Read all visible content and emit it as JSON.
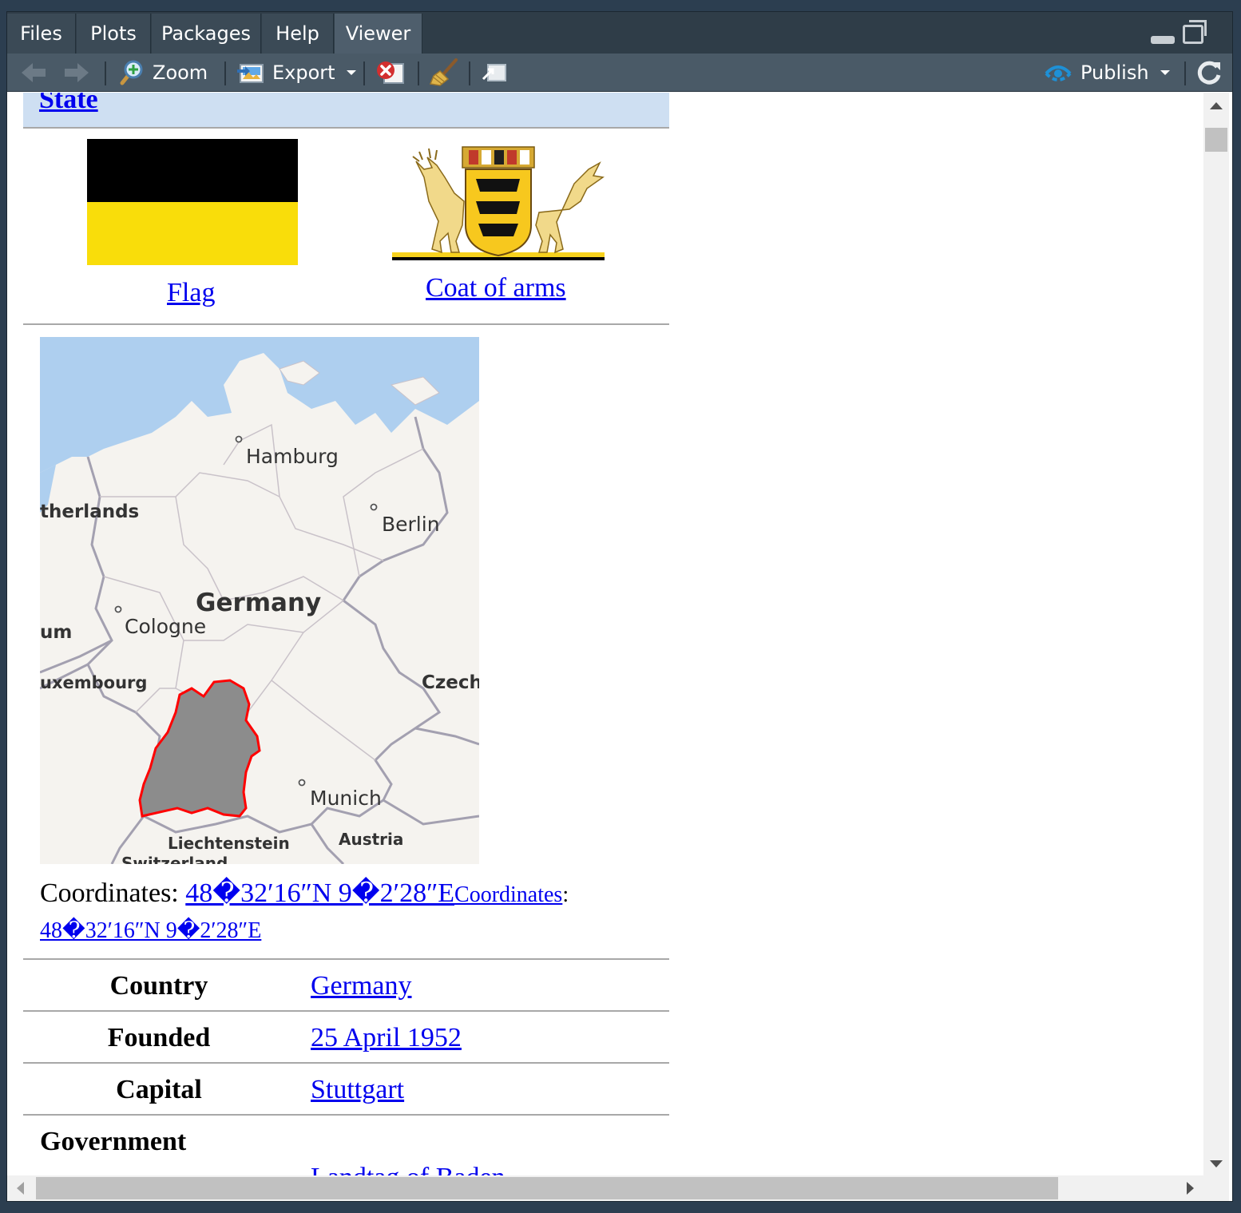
{
  "tabs": [
    {
      "label": "Files",
      "active": false
    },
    {
      "label": "Plots",
      "active": false
    },
    {
      "label": "Packages",
      "active": false
    },
    {
      "label": "Help",
      "active": false
    },
    {
      "label": "Viewer",
      "active": true
    }
  ],
  "toolbar": {
    "zoom_label": "Zoom",
    "export_label": "Export",
    "publish_label": "Publish"
  },
  "content": {
    "state_heading": "State",
    "flag_caption": "Flag",
    "coat_caption": "Coat of arms",
    "map_labels": {
      "hamburg": "Hamburg",
      "netherlands": "therlands",
      "berlin": "Berlin",
      "germany": "Germany",
      "cologne": "Cologne",
      "belgium": "um",
      "luxembourg": "uxembourg",
      "czech": "Czech",
      "munich": "Munich",
      "liechtenstein": "Liechtenstein",
      "austria": "Austria",
      "switzerland": "Switzerland"
    },
    "coordinates": {
      "label": "Coordinates: ",
      "value": "48�32′16″N 9�2′28″E",
      "small_label": "Coordinates",
      "small_colon": ":",
      "small_value": "48�32′16″N 9�2′28″E"
    },
    "info": [
      {
        "label": "Country",
        "value": "Germany"
      },
      {
        "label": "Founded",
        "value": "25 April 1952"
      },
      {
        "label": "Capital",
        "value": "Stuttgart"
      }
    ],
    "government_label": "Government",
    "partial_value": "Landtag of Baden-"
  },
  "colors": {
    "link": "#0000ee",
    "heading_bg": "#cedff2",
    "flag_black": "#000000",
    "flag_yellow": "#f9dd0a",
    "state_fill": "#8c8c8c",
    "state_border": "#ff0000",
    "water": "#aecfef",
    "land": "#f5f3ef"
  }
}
